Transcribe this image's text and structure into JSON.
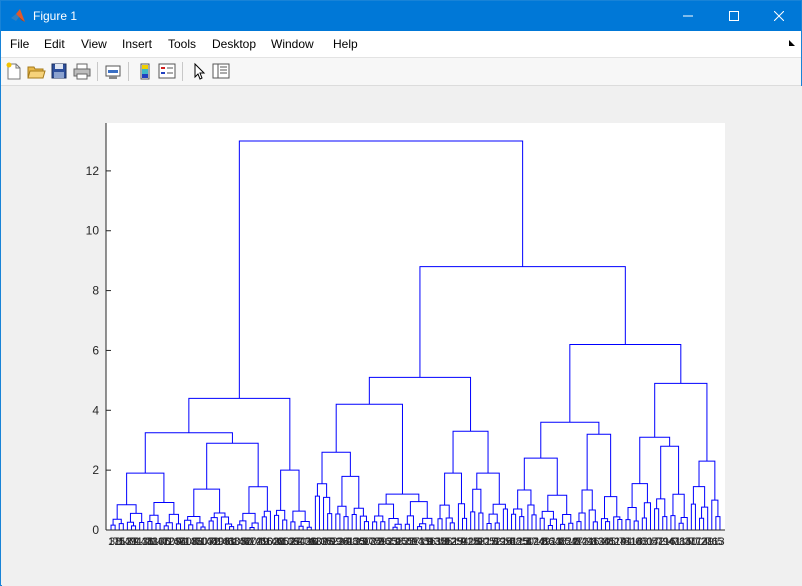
{
  "window": {
    "title": "Figure 1",
    "minimize_icon": "minimize-icon",
    "maximize_icon": "maximize-icon",
    "close_icon": "close-icon",
    "app_icon": "matlab-logo-icon"
  },
  "menu": {
    "items": [
      "File",
      "Edit",
      "View",
      "Insert",
      "Tools",
      "Desktop",
      "Window",
      "Help"
    ]
  },
  "toolbar": {
    "icons": [
      "new-figure-icon",
      "open-file-icon",
      "save-icon",
      "print-icon",
      "link-plot-icon",
      "insert-colorbar-icon",
      "insert-legend-icon",
      "edit-plot-arrow-icon",
      "property-inspector-icon"
    ]
  },
  "colors": {
    "title_bar": "#0078d7",
    "plot_line": "#0000ff",
    "axes_background": "#ffffff",
    "figure_background": "#f0f0f0"
  },
  "chart_data": {
    "type": "dendrogram",
    "y_ticks": [
      "0",
      "2",
      "4",
      "6",
      "8",
      "10",
      "12"
    ],
    "ylim": [
      0,
      13.6
    ],
    "grid": false,
    "leaf_count": 150,
    "leaf_labels_note": "150 overlapping leaf index labels along x-axis; the first begins \"1\" and the last ends \"5\"",
    "first_leaf_label": "1",
    "last_leaf_label": "5",
    "heights": {
      "root": 13.0,
      "left_cluster": 4.4,
      "right_cluster": 8.8,
      "right_left_subcluster": 5.1,
      "right_right_subcluster": 6.2,
      "rr_right": 4.9,
      "rr_left": 3.6,
      "rl_left": 4.2,
      "rl_right": 3.3,
      "left_left": 3.25,
      "left_right": 2.0,
      "ll_a": 2.9,
      "ll_b": 1.9,
      "rl_l_a": 2.6,
      "rl_r_a": 1.9,
      "rr_l_a": 2.4,
      "rr_l_b": 3.2,
      "rr_r_a": 3.1,
      "rr_r_b": 2.3,
      "rr_r_a_a": 1.55,
      "rr_r_a_b": 2.8,
      "rr_r_b_a": 1.45
    }
  }
}
